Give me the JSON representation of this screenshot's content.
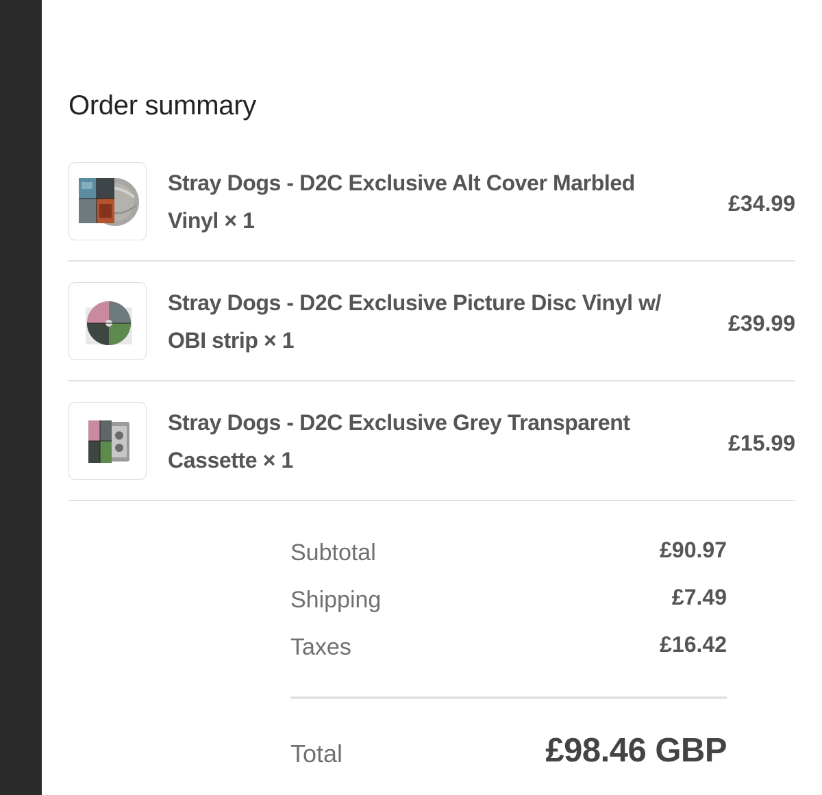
{
  "order_summary": {
    "title": "Order summary",
    "items": [
      {
        "name": "Stray Dogs - D2C Exclusive Alt Cover Marbled Vinyl × 1",
        "price": "£34.99",
        "thumbnail": "marbled-vinyl-thumbnail"
      },
      {
        "name": "Stray Dogs - D2C Exclusive Picture Disc Vinyl w/ OBI strip × 1",
        "price": "£39.99",
        "thumbnail": "picture-disc-thumbnail"
      },
      {
        "name": "Stray Dogs - D2C Exclusive Grey Transparent Cassette × 1",
        "price": "£15.99",
        "thumbnail": "cassette-thumbnail"
      }
    ],
    "subtotal_label": "Subtotal",
    "subtotal_value": "£90.97",
    "shipping_label": "Shipping",
    "shipping_value": "£7.49",
    "taxes_label": "Taxes",
    "taxes_value": "£16.42",
    "total_label": "Total",
    "total_value": "£98.46 GBP"
  },
  "colors": {
    "sidebar": "#2b2b2c",
    "text_primary": "#555555",
    "text_muted": "#707070",
    "divider": "#e3e3e3"
  }
}
